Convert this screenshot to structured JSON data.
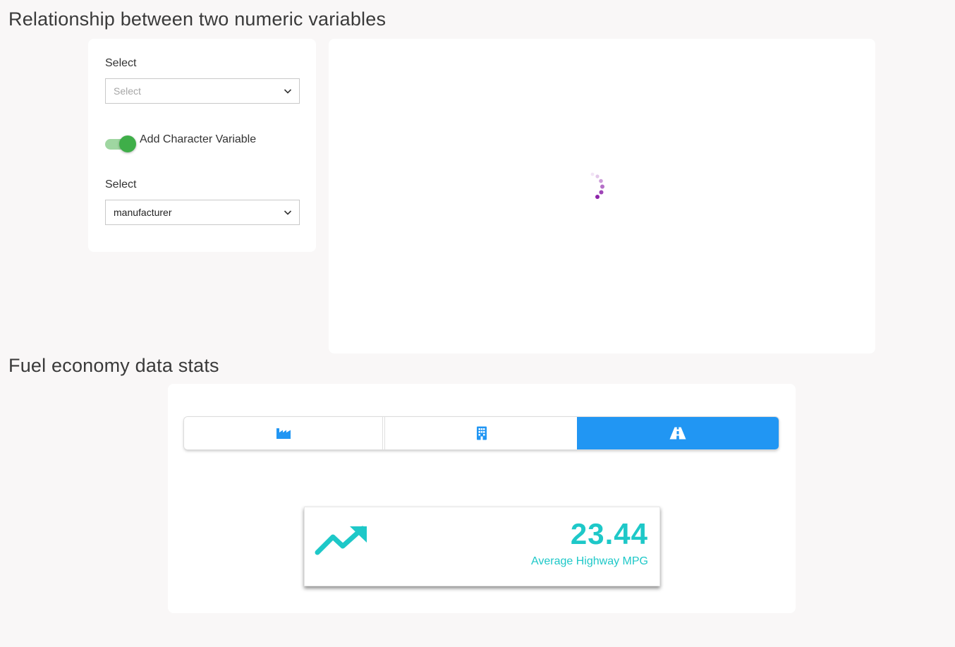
{
  "sections": {
    "relationship_title": "Relationship between two numeric variables",
    "stats_title": "Fuel economy data stats"
  },
  "controls": {
    "select_1": {
      "label": "Select",
      "placeholder": "Select",
      "value": ""
    },
    "toggle": {
      "label": "Add Character Variable",
      "checked": true
    },
    "select_2": {
      "label": "Select",
      "value": "manufacturer"
    }
  },
  "plot": {
    "state": "loading",
    "spinner_icon": "loading-spinner-icon",
    "spinner_color": "#8e24aa"
  },
  "stats": {
    "tabs": [
      {
        "icon": "factory-icon",
        "active": false
      },
      {
        "icon": "building-icon",
        "active": false
      },
      {
        "icon": "road-icon",
        "active": true
      }
    ],
    "value_box": {
      "icon": "trend-up-icon",
      "value": "23.44",
      "caption": "Average Highway MPG",
      "color": "#1ec8c8"
    }
  },
  "colors": {
    "background": "#f9f7f7",
    "accent_blue": "#2196f3",
    "toggle_green": "#3fae49",
    "teal": "#1ec8c8"
  }
}
